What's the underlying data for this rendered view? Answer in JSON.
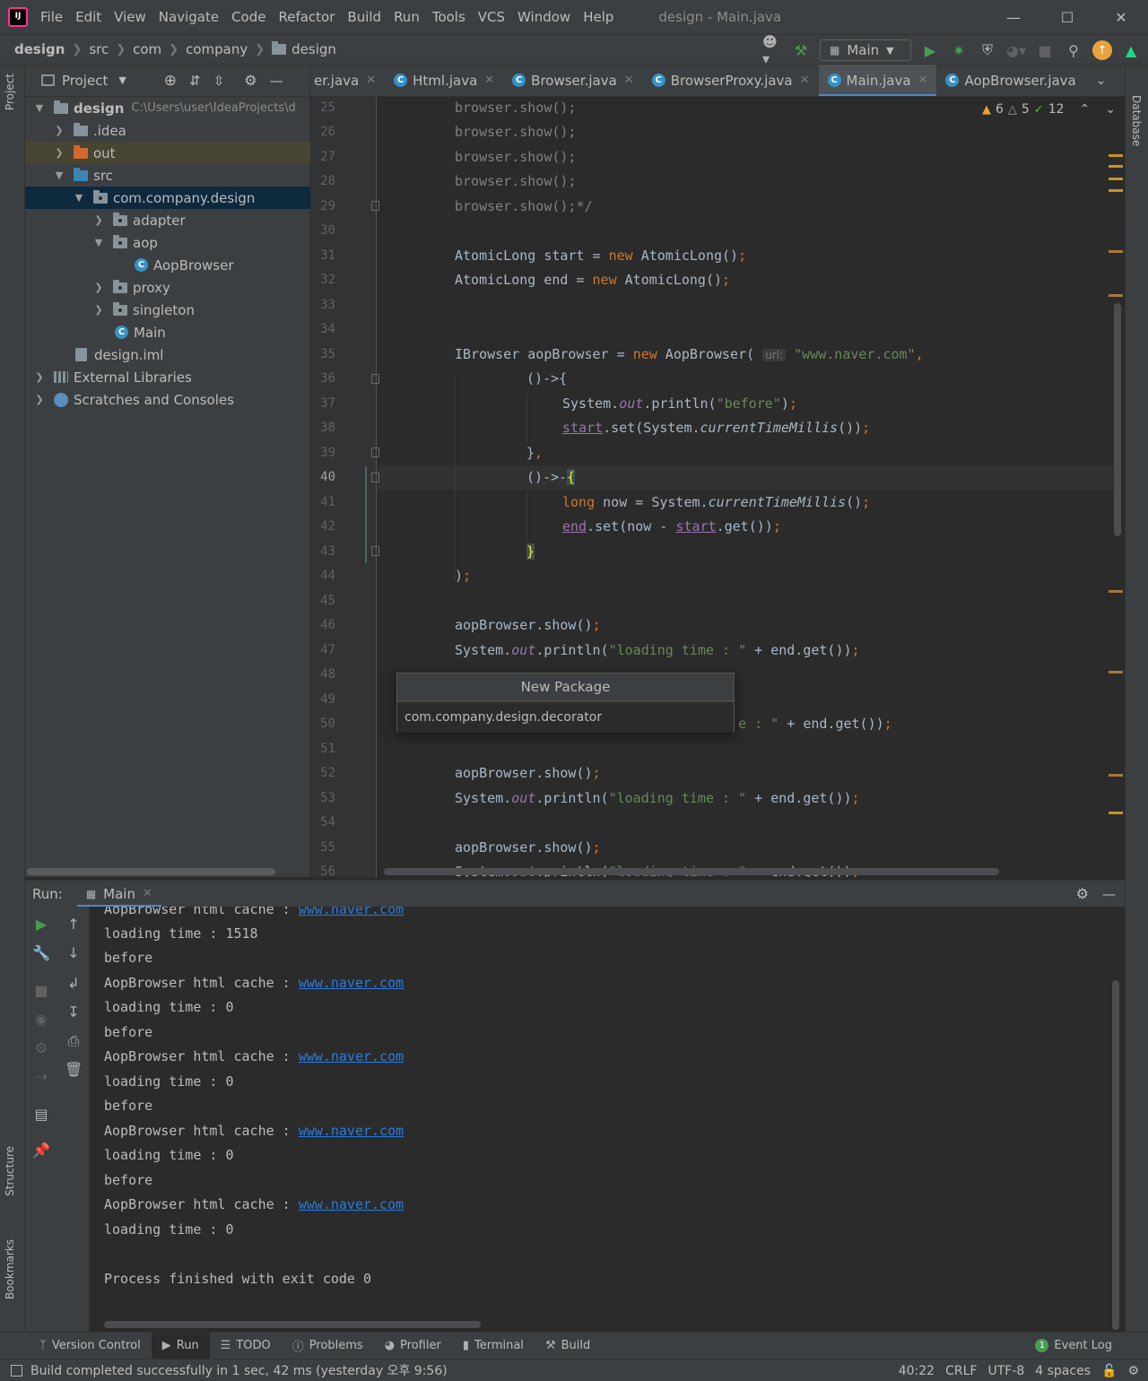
{
  "menubar": {
    "items": [
      "File",
      "Edit",
      "View",
      "Navigate",
      "Code",
      "Refactor",
      "Build",
      "Run",
      "Tools",
      "VCS",
      "Window",
      "Help"
    ],
    "window_title": "design - Main.java"
  },
  "navbar": {
    "crumbs": [
      "design",
      "src",
      "com",
      "company",
      "design"
    ],
    "run_config": "Main"
  },
  "stripes": {
    "left_top": "Project",
    "left_mid": "Structure",
    "left_bottom": "Bookmarks",
    "right": "Database"
  },
  "project": {
    "header": "Project",
    "tree": [
      {
        "label": "design",
        "hint": "C:\\Users\\user\\IdeaProjects\\d"
      },
      {
        "label": ".idea"
      },
      {
        "label": "out"
      },
      {
        "label": "src"
      },
      {
        "label": "com.company.design"
      },
      {
        "label": "adapter"
      },
      {
        "label": "aop"
      },
      {
        "label": "AopBrowser"
      },
      {
        "label": "proxy"
      },
      {
        "label": "singleton"
      },
      {
        "label": "Main"
      },
      {
        "label": "design.iml"
      },
      {
        "label": "External Libraries"
      },
      {
        "label": "Scratches and Consoles"
      }
    ]
  },
  "tabs": [
    "er.java",
    "Html.java",
    "Browser.java",
    "BrowserProxy.java",
    "Main.java",
    "AopBrowser.java"
  ],
  "inspections": {
    "warnings": "6",
    "weak": "5",
    "typos": "12"
  },
  "editor": {
    "line_numbers": [
      "25",
      "26",
      "27",
      "28",
      "29",
      "30",
      "31",
      "32",
      "33",
      "34",
      "35",
      "36",
      "37",
      "38",
      "39",
      "40",
      "41",
      "42",
      "43",
      "44",
      "45",
      "46",
      "47",
      "48",
      "49",
      "50",
      "51",
      "52",
      "53",
      "54",
      "55",
      "56"
    ],
    "current_line": "40"
  },
  "popup": {
    "title": "New Package",
    "value": "com.company.design.decorator"
  },
  "run": {
    "label": "Run:",
    "tab": "Main",
    "console": [
      {
        "text": "AopBrowser html cache : ",
        "link": "www.naver.com"
      },
      {
        "text": "loading time : 1518"
      },
      {
        "text": "before"
      },
      {
        "text": "AopBrowser html cache : ",
        "link": "www.naver.com"
      },
      {
        "text": "loading time : 0"
      },
      {
        "text": "before"
      },
      {
        "text": "AopBrowser html cache : ",
        "link": "www.naver.com"
      },
      {
        "text": "loading time : 0"
      },
      {
        "text": "before"
      },
      {
        "text": "AopBrowser html cache : ",
        "link": "www.naver.com"
      },
      {
        "text": "loading time : 0"
      },
      {
        "text": "before"
      },
      {
        "text": "AopBrowser html cache : ",
        "link": "www.naver.com"
      },
      {
        "text": "loading time : 0"
      },
      {
        "text": ""
      },
      {
        "text": "Process finished with exit code 0"
      }
    ]
  },
  "bottom_tools": [
    "Version Control",
    "Run",
    "TODO",
    "Problems",
    "Profiler",
    "Terminal",
    "Build"
  ],
  "event_log": {
    "count": "1",
    "label": "Event Log"
  },
  "status": {
    "message": "Build completed successfully in 1 sec, 42 ms (yesterday 오후 9:56)",
    "position": "40:22",
    "line_sep": "CRLF",
    "encoding": "UTF-8",
    "indent": "4 spaces"
  }
}
